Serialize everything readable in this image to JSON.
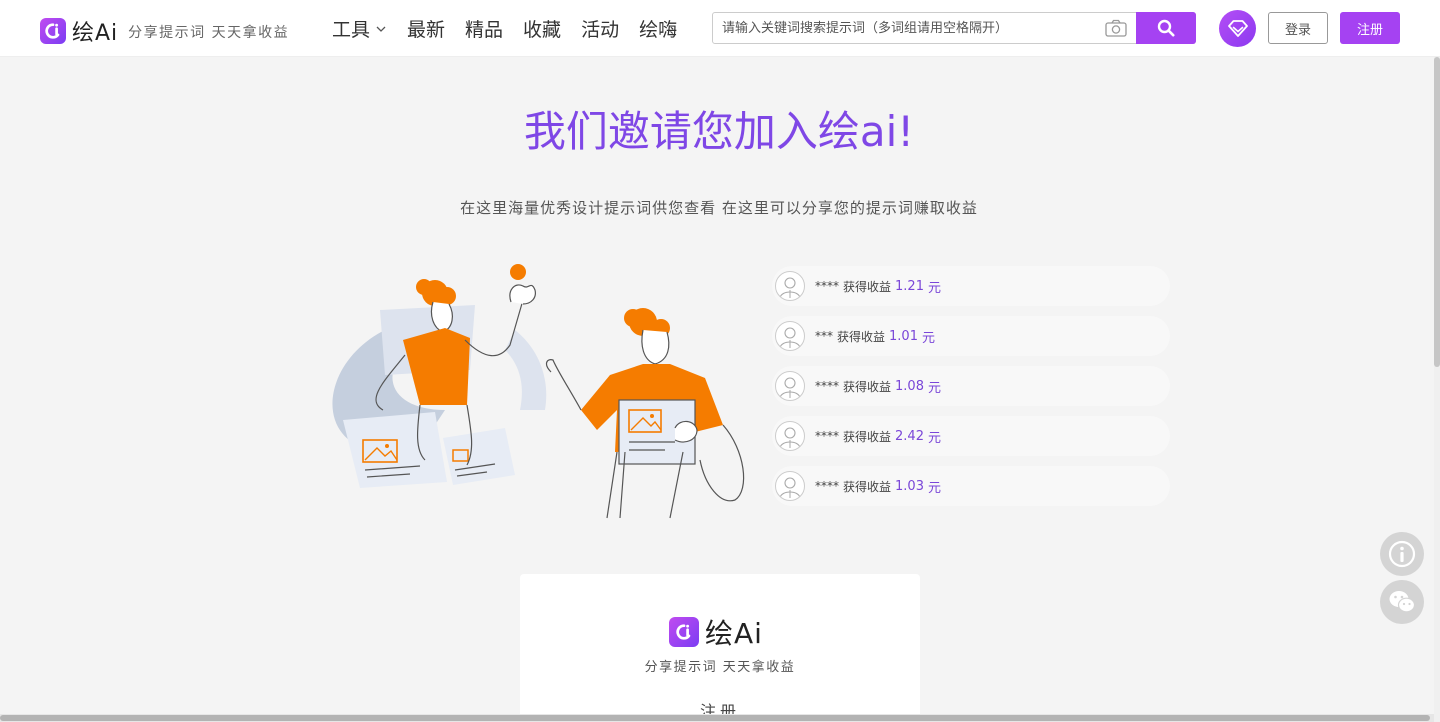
{
  "header": {
    "logo_text": "绘Ai",
    "slogan": "分享提示词 天天拿收益",
    "nav": [
      {
        "label": "工具",
        "has_dropdown": true
      },
      {
        "label": "最新"
      },
      {
        "label": "精品"
      },
      {
        "label": "收藏"
      },
      {
        "label": "活动"
      },
      {
        "label": "绘嗨"
      }
    ],
    "search_placeholder": "请输入关键词搜索提示词（多词组请用空格隔开）",
    "login_label": "登录",
    "register_label": "注册"
  },
  "hero": {
    "title": "我们邀请您加入绘ai!",
    "subtitle": "在这里海量优秀设计提示词供您查看 在这里可以分享您的提示词赚取收益"
  },
  "earnings": [
    {
      "name": "****",
      "label": "获得收益",
      "amount": "1.21",
      "unit": "元"
    },
    {
      "name": "***",
      "label": "获得收益",
      "amount": "1.01",
      "unit": "元"
    },
    {
      "name": "****",
      "label": "获得收益",
      "amount": "1.08",
      "unit": "元"
    },
    {
      "name": "****",
      "label": "获得收益",
      "amount": "2.42",
      "unit": "元"
    },
    {
      "name": "****",
      "label": "获得收益",
      "amount": "1.03",
      "unit": "元"
    }
  ],
  "card": {
    "logo_text": "绘Ai",
    "slogan": "分享提示词 天天拿收益",
    "register_label": "注册"
  },
  "colors": {
    "brand": "#a542f2",
    "title": "#7f47e6",
    "accent_orange": "#f57c00"
  }
}
